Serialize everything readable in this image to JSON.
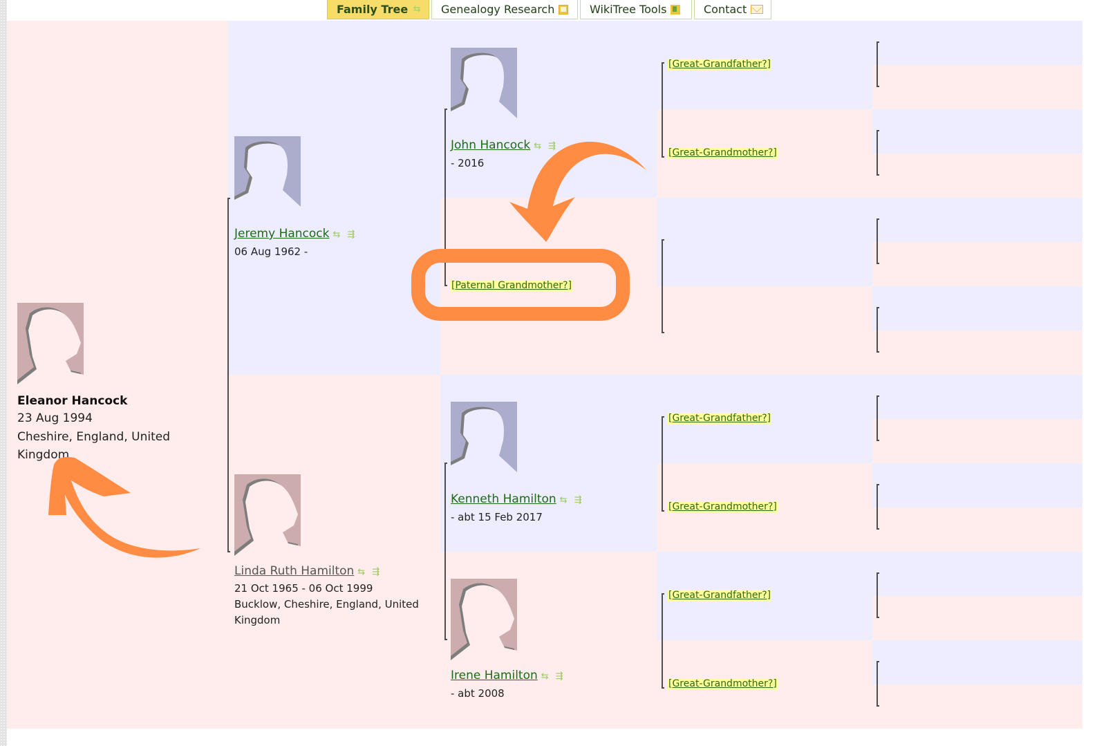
{
  "nav": {
    "tabs": [
      {
        "label": "Family Tree",
        "icon": "tree-icon",
        "active": true
      },
      {
        "label": "Genealogy Research",
        "icon": "research-icon",
        "active": false
      },
      {
        "label": "WikiTree Tools",
        "icon": "tools-icon",
        "active": false
      },
      {
        "label": "Contact",
        "icon": "mail-icon",
        "active": false
      }
    ]
  },
  "colors": {
    "female_bg": "#ffecec",
    "male_bg": "#eeedff",
    "link": "#1c6b16",
    "unknown_highlight": "#ffff99",
    "annotation": "#ff8c42",
    "active_tab": "#f6dd6a"
  },
  "subject": {
    "name": "Eleanor Hancock",
    "birth": "23 Aug 1994",
    "place": "Cheshire, England, United Kingdom",
    "gender": "female"
  },
  "parents": {
    "father": {
      "name": "Jeremy Hancock",
      "dates": "06 Aug 1962 -",
      "icons": "⇆ ⇶",
      "gender": "male"
    },
    "mother": {
      "name": "Linda Ruth Hamilton",
      "dates": "21 Oct 1965 - 06 Oct 1999",
      "place": "Bucklow, Cheshire, England, United Kingdom",
      "icons": "⇆ ⇶",
      "gender": "female"
    }
  },
  "grandparents": {
    "paternal_grandfather": {
      "name": "John Hancock",
      "dates": "- 2016",
      "icons": "⇆ ⇶"
    },
    "paternal_grandmother": {
      "label": "[Paternal Grandmother?]"
    },
    "maternal_grandfather": {
      "name": "Kenneth Hamilton",
      "dates": "- abt 15 Feb 2017",
      "icons": "⇆ ⇶"
    },
    "maternal_grandmother": {
      "name": "Irene Hamilton",
      "dates": "- abt 2008",
      "icons": "⇆ ⇶"
    }
  },
  "great_grandparents": [
    {
      "label": "[Great-Grandfather?]"
    },
    {
      "label": "[Great-Grandmother?]"
    },
    {
      "label": ""
    },
    {
      "label": ""
    },
    {
      "label": "[Great-Grandfather?]"
    },
    {
      "label": "[Great-Grandmother?]"
    },
    {
      "label": "[Great-Grandfather?]"
    },
    {
      "label": "[Great-Grandmother?]"
    }
  ],
  "annotations": {
    "highlight_target": "[Paternal Grandmother?]"
  }
}
